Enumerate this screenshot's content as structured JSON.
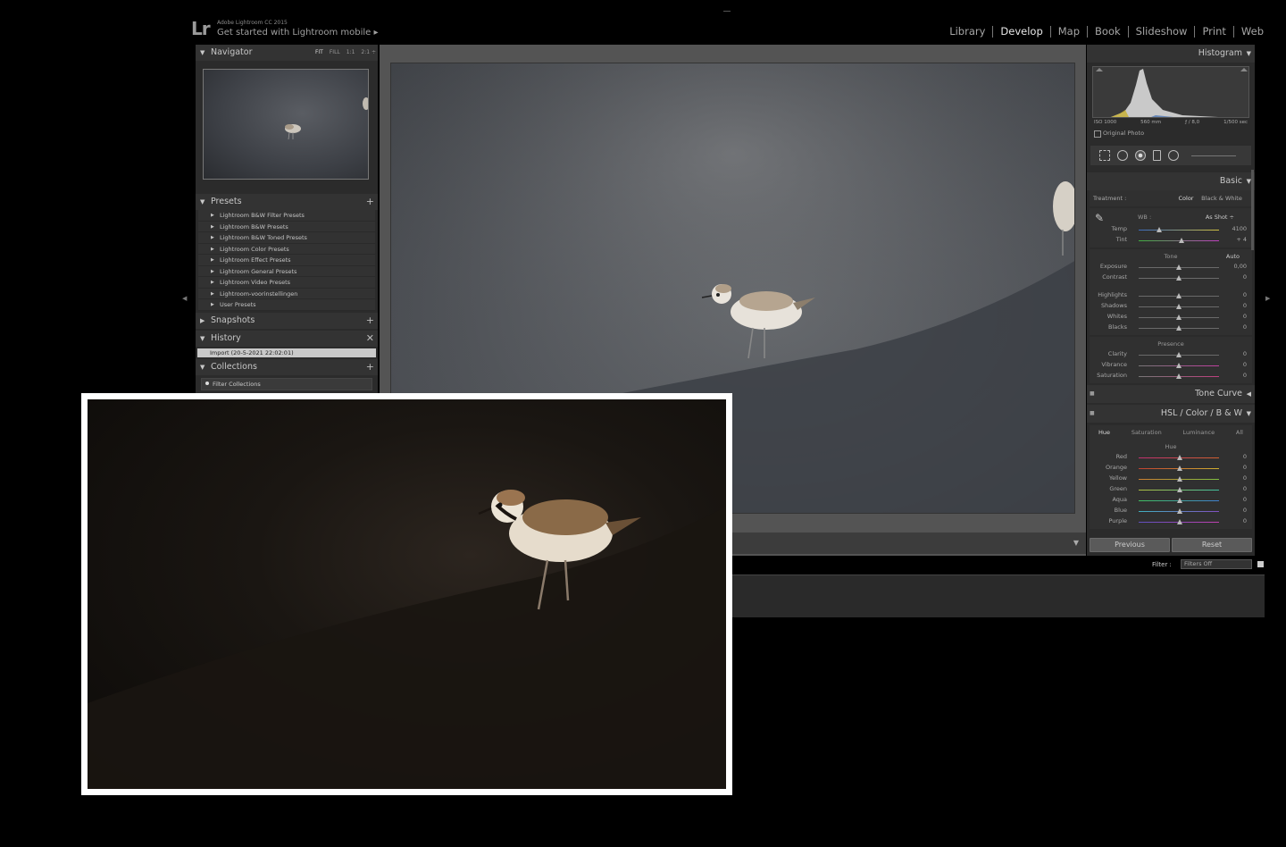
{
  "app": {
    "logo": "Lr",
    "brand_small": "Adobe Lightroom CC 2015",
    "brand_main": "Get started with Lightroom mobile  ▸"
  },
  "modules": [
    {
      "label": "Library",
      "active": false
    },
    {
      "label": "Develop",
      "active": true
    },
    {
      "label": "Map",
      "active": false
    },
    {
      "label": "Book",
      "active": false
    },
    {
      "label": "Slideshow",
      "active": false
    },
    {
      "label": "Print",
      "active": false
    },
    {
      "label": "Web",
      "active": false
    }
  ],
  "left": {
    "navigator": {
      "title": "Navigator",
      "opts": [
        "FIT",
        "FILL",
        "1:1",
        "2:1 ÷"
      ]
    },
    "presets": {
      "title": "Presets",
      "items": [
        "Lightroom B&W Filter Presets",
        "Lightroom B&W Presets",
        "Lightroom B&W Toned Presets",
        "Lightroom Color Presets",
        "Lightroom Effect Presets",
        "Lightroom General Presets",
        "Lightroom Video Presets",
        "Lightroom-voorinstellingen",
        "User Presets"
      ]
    },
    "snapshots": {
      "title": "Snapshots"
    },
    "history": {
      "title": "History",
      "item": "Import (20-5-2021 22:02:01)"
    },
    "collections": {
      "title": "Collections",
      "filter": "Filter Collections"
    }
  },
  "right": {
    "histogram": {
      "title": "Histogram",
      "exif": [
        "ISO 1000",
        "560 mm",
        "ƒ / 8,0",
        "1/500 sec"
      ],
      "original_photo": "Original Photo"
    },
    "basic": {
      "title": "Basic",
      "treatment_label": "Treatment :",
      "treatment_color": "Color",
      "treatment_bw": "Black & White",
      "wb_label": "WB :",
      "wb_value": "As Shot ÷",
      "temp": {
        "name": "Temp",
        "value": "4100"
      },
      "tint": {
        "name": "Tint",
        "value": "+ 4"
      },
      "tone_label": "Tone",
      "auto_label": "Auto",
      "exposure": {
        "name": "Exposure",
        "value": "0,00"
      },
      "contrast": {
        "name": "Contrast",
        "value": "0"
      },
      "highlights": {
        "name": "Highlights",
        "value": "0"
      },
      "shadows": {
        "name": "Shadows",
        "value": "0"
      },
      "whites": {
        "name": "Whites",
        "value": "0"
      },
      "blacks": {
        "name": "Blacks",
        "value": "0"
      },
      "presence_label": "Presence",
      "clarity": {
        "name": "Clarity",
        "value": "0"
      },
      "vibrance": {
        "name": "Vibrance",
        "value": "0"
      },
      "saturation": {
        "name": "Saturation",
        "value": "0"
      }
    },
    "tone_curve": {
      "title": "Tone Curve"
    },
    "hsl": {
      "title": "HSL  /  Color  /  B & W",
      "tabs": [
        "Hue",
        "Saturation",
        "Luminance",
        "All"
      ],
      "sub": "Hue",
      "rows": [
        {
          "name": "Red",
          "value": "0"
        },
        {
          "name": "Orange",
          "value": "0"
        },
        {
          "name": "Yellow",
          "value": "0"
        },
        {
          "name": "Green",
          "value": "0"
        },
        {
          "name": "Aqua",
          "value": "0"
        },
        {
          "name": "Blue",
          "value": "0"
        },
        {
          "name": "Purple",
          "value": "0"
        }
      ]
    },
    "previous": "Previous",
    "reset": "Reset"
  },
  "filter": {
    "label": "Filter :",
    "value": "Filters Off"
  },
  "colors": {
    "background": "#000000",
    "panel": "#2b2b2b",
    "center": "#545454"
  }
}
